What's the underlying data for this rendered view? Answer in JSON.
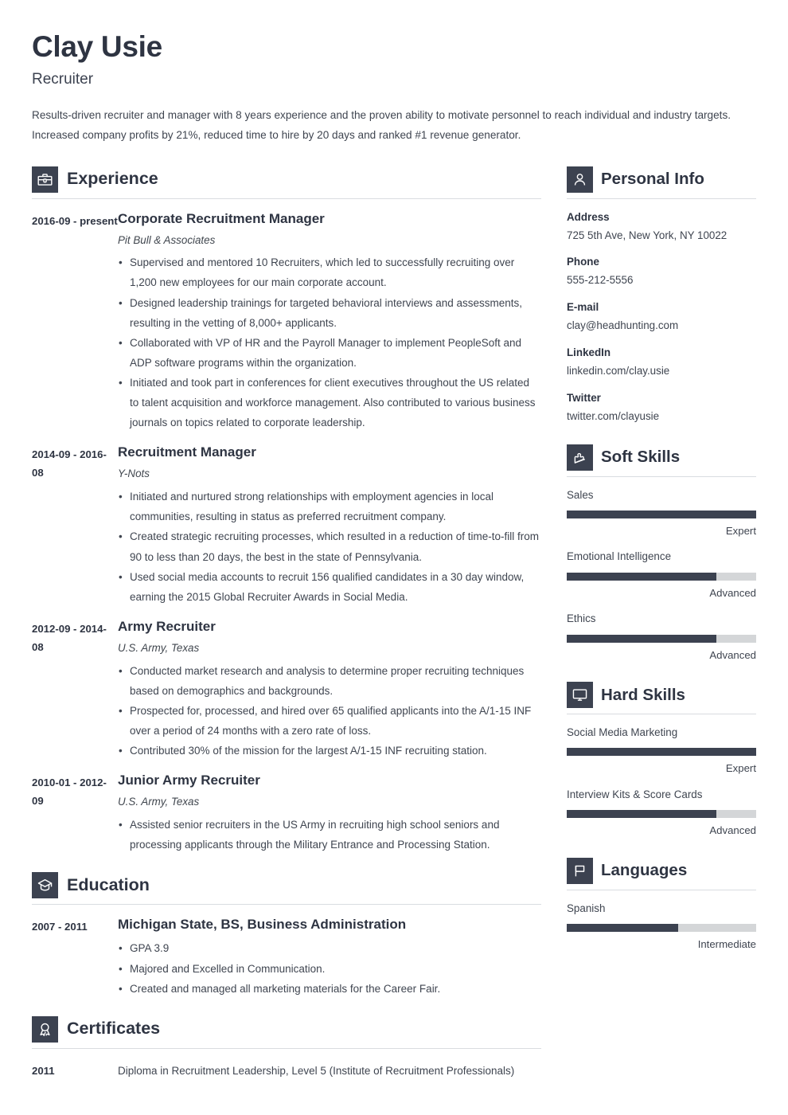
{
  "header": {
    "name": "Clay Usie",
    "job_title": "Recruiter",
    "summary": "Results-driven recruiter and manager with 8 years experience and the proven ability to motivate personnel to reach individual and industry targets. Increased company profits by 21%, reduced time to hire by 20 days and ranked #1 revenue generator."
  },
  "theme": {
    "accent": "#3c4250",
    "heading": "#2e3442",
    "body_text": "#3f4550",
    "rule": "#d9dce0",
    "bar_track": "#d4d6d8"
  },
  "sections": {
    "experience": {
      "title": "Experience",
      "icon": "briefcase-icon",
      "entries": [
        {
          "date": "2016-09 - present",
          "role": "Corporate Recruitment Manager",
          "org": "Pit Bull & Associates",
          "bullets": [
            "Supervised and mentored 10 Recruiters, which led to successfully recruiting over 1,200 new employees for our main corporate account.",
            "Designed leadership trainings for targeted behavioral interviews and assessments, resulting in the vetting of 8,000+ applicants.",
            "Collaborated with VP of HR and the Payroll Manager to implement PeopleSoft and ADP software programs within the organization.",
            "Initiated and took part in conferences for client executives throughout the US related to talent acquisition and workforce management. Also contributed to various business journals on topics related to corporate leadership."
          ]
        },
        {
          "date": "2014-09 - 2016-08",
          "role": "Recruitment Manager",
          "org": "Y-Nots",
          "bullets": [
            "Initiated and nurtured strong relationships with employment agencies in local communities, resulting in status as preferred recruitment company.",
            "Created strategic recruiting processes, which resulted in a reduction of time-to-fill from 90 to less than 20 days, the best in the state of Pennsylvania.",
            "Used social media accounts to recruit 156 qualified candidates in a 30 day window, earning the 2015 Global Recruiter Awards in Social Media."
          ]
        },
        {
          "date": "2012-09 - 2014-08",
          "role": "Army Recruiter",
          "org": "U.S. Army, Texas",
          "bullets": [
            "Conducted market research and analysis to determine proper recruiting techniques based on demographics and backgrounds.",
            "Prospected for, processed, and hired over 65 qualified applicants into the A/1-15 INF over a period of 24 months with a zero rate of loss.",
            "Contributed 30% of the mission for the largest A/1-15 INF recruiting station."
          ]
        },
        {
          "date": "2010-01 - 2012-09",
          "role": "Junior Army Recruiter",
          "org": "U.S. Army, Texas",
          "bullets": [
            "Assisted senior recruiters in the US Army in recruiting high school seniors and processing applicants through the Military Entrance and Processing Station."
          ]
        }
      ]
    },
    "education": {
      "title": "Education",
      "icon": "graduation-cap-icon",
      "entries": [
        {
          "date": "2007 - 2011",
          "role": "Michigan State, BS, Business Administration",
          "org": "",
          "bullets": [
            "GPA 3.9",
            "Majored and Excelled in Communication.",
            "Created and managed all marketing materials for the Career Fair."
          ]
        }
      ]
    },
    "certificates": {
      "title": "Certificates",
      "icon": "award-ribbon-icon",
      "entries": [
        {
          "date": "2011",
          "text": "Diploma in Recruitment Leadership, Level 5  (Institute of Recruitment Professionals)"
        }
      ]
    },
    "personal_info": {
      "title": "Personal Info",
      "icon": "person-icon",
      "items": [
        {
          "label": "Address",
          "value": "725 5th Ave, New York, NY 10022"
        },
        {
          "label": "Phone",
          "value": "555-212-5556"
        },
        {
          "label": "E-mail",
          "value": "clay@headhunting.com"
        },
        {
          "label": "LinkedIn",
          "value": "linkedin.com/clay.usie"
        },
        {
          "label": "Twitter",
          "value": "twitter.com/clayusie"
        }
      ]
    },
    "soft_skills": {
      "title": "Soft Skills",
      "icon": "puzzle-piece-icon",
      "items": [
        {
          "name": "Sales",
          "level": "Expert",
          "percent": 100
        },
        {
          "name": "Emotional Intelligence",
          "level": "Advanced",
          "percent": 79
        },
        {
          "name": "Ethics",
          "level": "Advanced",
          "percent": 79
        }
      ]
    },
    "hard_skills": {
      "title": "Hard Skills",
      "icon": "monitor-icon",
      "items": [
        {
          "name": "Social Media Marketing",
          "level": "Expert",
          "percent": 100
        },
        {
          "name": "Interview Kits & Score Cards",
          "level": "Advanced",
          "percent": 79
        }
      ]
    },
    "languages": {
      "title": "Languages",
      "icon": "flag-icon",
      "items": [
        {
          "name": "Spanish",
          "level": "Intermediate",
          "percent": 59
        }
      ]
    }
  }
}
